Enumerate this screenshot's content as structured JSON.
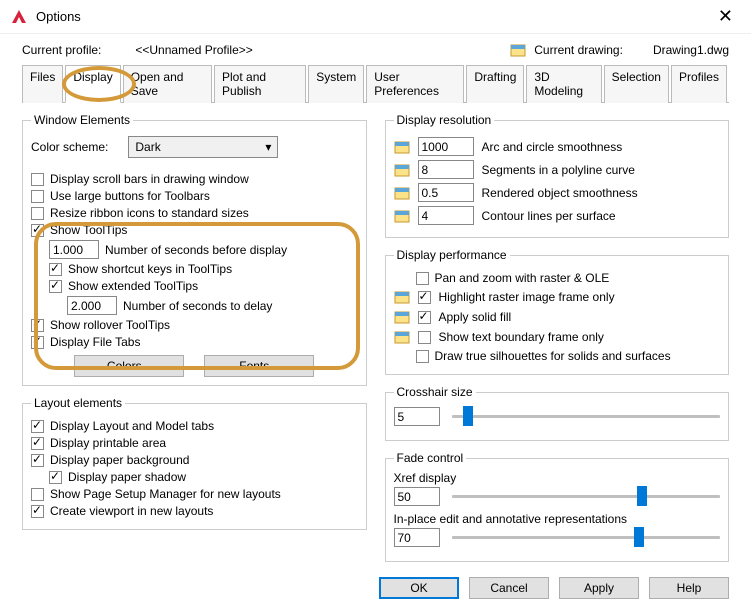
{
  "window": {
    "title": "Options"
  },
  "profile": {
    "current_label": "Current profile:",
    "current_value": "<<Unnamed Profile>>",
    "drawing_label": "Current drawing:",
    "drawing_value": "Drawing1.dwg"
  },
  "tabs": {
    "files": "Files",
    "display": "Display",
    "open_and_save": "Open and Save",
    "plot_and_publish": "Plot and Publish",
    "system": "System",
    "user_preferences": "User Preferences",
    "drafting": "Drafting",
    "modeling_3d": "3D Modeling",
    "selection": "Selection",
    "profiles": "Profiles"
  },
  "window_elements": {
    "legend": "Window Elements",
    "color_scheme_label": "Color scheme:",
    "color_scheme_value": "Dark",
    "scroll_bars": "Display scroll bars in drawing window",
    "large_buttons": "Use large buttons for Toolbars",
    "resize_ribbon": "Resize ribbon icons to standard sizes",
    "show_tooltips": "Show ToolTips",
    "tooltip_delay_value": "1.000",
    "tooltip_delay_label": "Number of seconds before display",
    "show_shortcut": "Show shortcut keys in ToolTips",
    "show_extended": "Show extended ToolTips",
    "extended_delay_value": "2.000",
    "extended_delay_label": "Number of seconds to delay",
    "show_rollover": "Show rollover ToolTips",
    "display_file_tabs": "Display File Tabs",
    "colors_btn": "Colors...",
    "fonts_btn": "Fonts..."
  },
  "layout_elements": {
    "legend": "Layout elements",
    "layout_model_tabs": "Display Layout and Model tabs",
    "printable_area": "Display printable area",
    "paper_background": "Display paper background",
    "paper_shadow": "Display paper shadow",
    "page_setup_mgr": "Show Page Setup Manager for new layouts",
    "create_viewport": "Create viewport in new layouts"
  },
  "display_resolution": {
    "legend": "Display resolution",
    "arc_value": "1000",
    "arc_label": "Arc and circle smoothness",
    "seg_value": "8",
    "seg_label": "Segments in a polyline curve",
    "rendered_value": "0.5",
    "rendered_label": "Rendered object smoothness",
    "contour_value": "4",
    "contour_label": "Contour lines per surface"
  },
  "display_performance": {
    "legend": "Display performance",
    "pan_zoom": "Pan and zoom with raster & OLE",
    "highlight_raster": "Highlight raster image frame only",
    "apply_solid": "Apply solid fill",
    "text_boundary": "Show text boundary frame only",
    "true_silhouettes": "Draw true silhouettes for solids and surfaces"
  },
  "crosshair": {
    "legend": "Crosshair size",
    "value": "5"
  },
  "fade": {
    "legend": "Fade control",
    "xref_label": "Xref display",
    "xref_value": "50",
    "inplace_label": "In-place edit and annotative representations",
    "inplace_value": "70"
  },
  "footer": {
    "ok": "OK",
    "cancel": "Cancel",
    "apply": "Apply",
    "help": "Help"
  }
}
